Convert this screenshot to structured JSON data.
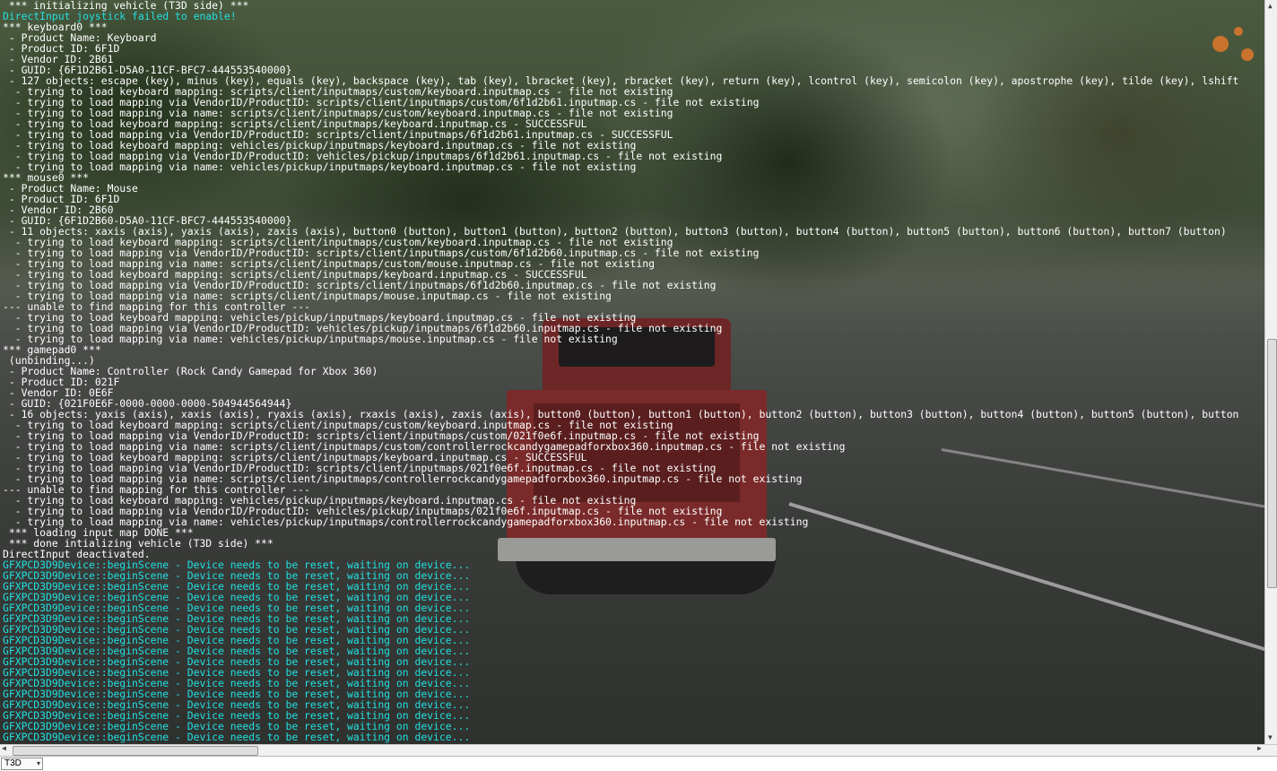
{
  "console": {
    "lines": [
      {
        "text": " *** initializing vehicle (T3D side) ***",
        "cyan": false
      },
      {
        "text": "DirectInput joystick failed to enable!",
        "cyan": true
      },
      {
        "text": "*** keyboard0 ***",
        "cyan": false
      },
      {
        "text": " - Product Name: Keyboard",
        "cyan": false
      },
      {
        "text": " - Product ID: 6F1D",
        "cyan": false
      },
      {
        "text": " - Vendor ID: 2B61",
        "cyan": false
      },
      {
        "text": " - GUID: {6F1D2B61-D5A0-11CF-BFC7-444553540000}",
        "cyan": false
      },
      {
        "text": " - 127 objects: escape (key), minus (key), equals (key), backspace (key), tab (key), lbracket (key), rbracket (key), return (key), lcontrol (key), semicolon (key), apostrophe (key), tilde (key), lshift",
        "cyan": false
      },
      {
        "text": "  - trying to load keyboard mapping: scripts/client/inputmaps/custom/keyboard.inputmap.cs - file not existing",
        "cyan": false
      },
      {
        "text": "  - trying to load mapping via VendorID/ProductID: scripts/client/inputmaps/custom/6f1d2b61.inputmap.cs - file not existing",
        "cyan": false
      },
      {
        "text": "  - trying to load mapping via name: scripts/client/inputmaps/custom/keyboard.inputmap.cs - file not existing",
        "cyan": false
      },
      {
        "text": "  - trying to load keyboard mapping: scripts/client/inputmaps/keyboard.inputmap.cs - SUCCESSFUL",
        "cyan": false
      },
      {
        "text": "  - trying to load mapping via VendorID/ProductID: scripts/client/inputmaps/6f1d2b61.inputmap.cs - SUCCESSFUL",
        "cyan": false
      },
      {
        "text": "  - trying to load keyboard mapping: vehicles/pickup/inputmaps/keyboard.inputmap.cs - file not existing",
        "cyan": false
      },
      {
        "text": "  - trying to load mapping via VendorID/ProductID: vehicles/pickup/inputmaps/6f1d2b61.inputmap.cs - file not existing",
        "cyan": false
      },
      {
        "text": "  - trying to load mapping via name: vehicles/pickup/inputmaps/keyboard.inputmap.cs - file not existing",
        "cyan": false
      },
      {
        "text": "*** mouse0 ***",
        "cyan": false
      },
      {
        "text": " - Product Name: Mouse",
        "cyan": false
      },
      {
        "text": " - Product ID: 6F1D",
        "cyan": false
      },
      {
        "text": " - Vendor ID: 2B60",
        "cyan": false
      },
      {
        "text": " - GUID: {6F1D2B60-D5A0-11CF-BFC7-444553540000}",
        "cyan": false
      },
      {
        "text": " - 11 objects: xaxis (axis), yaxis (axis), zaxis (axis), button0 (button), button1 (button), button2 (button), button3 (button), button4 (button), button5 (button), button6 (button), button7 (button)",
        "cyan": false
      },
      {
        "text": "  - trying to load keyboard mapping: scripts/client/inputmaps/custom/keyboard.inputmap.cs - file not existing",
        "cyan": false
      },
      {
        "text": "  - trying to load mapping via VendorID/ProductID: scripts/client/inputmaps/custom/6f1d2b60.inputmap.cs - file not existing",
        "cyan": false
      },
      {
        "text": "  - trying to load mapping via name: scripts/client/inputmaps/custom/mouse.inputmap.cs - file not existing",
        "cyan": false
      },
      {
        "text": "  - trying to load keyboard mapping: scripts/client/inputmaps/keyboard.inputmap.cs - SUCCESSFUL",
        "cyan": false
      },
      {
        "text": "  - trying to load mapping via VendorID/ProductID: scripts/client/inputmaps/6f1d2b60.inputmap.cs - file not existing",
        "cyan": false
      },
      {
        "text": "  - trying to load mapping via name: scripts/client/inputmaps/mouse.inputmap.cs - file not existing",
        "cyan": false
      },
      {
        "text": "--- unable to find mapping for this controller ---",
        "cyan": false
      },
      {
        "text": "  - trying to load keyboard mapping: vehicles/pickup/inputmaps/keyboard.inputmap.cs - file not existing",
        "cyan": false
      },
      {
        "text": "  - trying to load mapping via VendorID/ProductID: vehicles/pickup/inputmaps/6f1d2b60.inputmap.cs - file not existing",
        "cyan": false
      },
      {
        "text": "  - trying to load mapping via name: vehicles/pickup/inputmaps/mouse.inputmap.cs - file not existing",
        "cyan": false
      },
      {
        "text": "*** gamepad0 ***",
        "cyan": false
      },
      {
        "text": " (unbinding...)",
        "cyan": false
      },
      {
        "text": " - Product Name: Controller (Rock Candy Gamepad for Xbox 360)",
        "cyan": false
      },
      {
        "text": " - Product ID: 021F",
        "cyan": false
      },
      {
        "text": " - Vendor ID: 0E6F",
        "cyan": false
      },
      {
        "text": " - GUID: {021F0E6F-0000-0000-0000-504944564944}",
        "cyan": false
      },
      {
        "text": " - 16 objects: yaxis (axis), xaxis (axis), ryaxis (axis), rxaxis (axis), zaxis (axis), button0 (button), button1 (button), button2 (button), button3 (button), button4 (button), button5 (button), button",
        "cyan": false
      },
      {
        "text": "  - trying to load keyboard mapping: scripts/client/inputmaps/custom/keyboard.inputmap.cs - file not existing",
        "cyan": false
      },
      {
        "text": "  - trying to load mapping via VendorID/ProductID: scripts/client/inputmaps/custom/021f0e6f.inputmap.cs - file not existing",
        "cyan": false
      },
      {
        "text": "  - trying to load mapping via name: scripts/client/inputmaps/custom/controllerrockcandygamepadforxbox360.inputmap.cs - file not existing",
        "cyan": false
      },
      {
        "text": "  - trying to load keyboard mapping: scripts/client/inputmaps/keyboard.inputmap.cs - SUCCESSFUL",
        "cyan": false
      },
      {
        "text": "  - trying to load mapping via VendorID/ProductID: scripts/client/inputmaps/021f0e6f.inputmap.cs - file not existing",
        "cyan": false
      },
      {
        "text": "  - trying to load mapping via name: scripts/client/inputmaps/controllerrockcandygamepadforxbox360.inputmap.cs - file not existing",
        "cyan": false
      },
      {
        "text": "--- unable to find mapping for this controller ---",
        "cyan": false
      },
      {
        "text": "  - trying to load keyboard mapping: vehicles/pickup/inputmaps/keyboard.inputmap.cs - file not existing",
        "cyan": false
      },
      {
        "text": "  - trying to load mapping via VendorID/ProductID: vehicles/pickup/inputmaps/021f0e6f.inputmap.cs - file not existing",
        "cyan": false
      },
      {
        "text": "  - trying to load mapping via name: vehicles/pickup/inputmaps/controllerrockcandygamepadforxbox360.inputmap.cs - file not existing",
        "cyan": false
      },
      {
        "text": " *** loading input map DONE ***",
        "cyan": false
      },
      {
        "text": " *** done intializing vehicle (T3D side) ***",
        "cyan": false
      },
      {
        "text": "DirectInput deactivated.",
        "cyan": false
      },
      {
        "text": "GFXPCD3D9Device::beginScene - Device needs to be reset, waiting on device...",
        "cyan": true
      },
      {
        "text": "GFXPCD3D9Device::beginScene - Device needs to be reset, waiting on device...",
        "cyan": true
      },
      {
        "text": "GFXPCD3D9Device::beginScene - Device needs to be reset, waiting on device...",
        "cyan": true
      },
      {
        "text": "GFXPCD3D9Device::beginScene - Device needs to be reset, waiting on device...",
        "cyan": true
      },
      {
        "text": "GFXPCD3D9Device::beginScene - Device needs to be reset, waiting on device...",
        "cyan": true
      },
      {
        "text": "GFXPCD3D9Device::beginScene - Device needs to be reset, waiting on device...",
        "cyan": true
      },
      {
        "text": "GFXPCD3D9Device::beginScene - Device needs to be reset, waiting on device...",
        "cyan": true
      },
      {
        "text": "GFXPCD3D9Device::beginScene - Device needs to be reset, waiting on device...",
        "cyan": true
      },
      {
        "text": "GFXPCD3D9Device::beginScene - Device needs to be reset, waiting on device...",
        "cyan": true
      },
      {
        "text": "GFXPCD3D9Device::beginScene - Device needs to be reset, waiting on device...",
        "cyan": true
      },
      {
        "text": "GFXPCD3D9Device::beginScene - Device needs to be reset, waiting on device...",
        "cyan": true
      },
      {
        "text": "GFXPCD3D9Device::beginScene - Device needs to be reset, waiting on device...",
        "cyan": true
      },
      {
        "text": "GFXPCD3D9Device::beginScene - Device needs to be reset, waiting on device...",
        "cyan": true
      },
      {
        "text": "GFXPCD3D9Device::beginScene - Device needs to be reset, waiting on device...",
        "cyan": true
      },
      {
        "text": "GFXPCD3D9Device::beginScene - Device needs to be reset, waiting on device...",
        "cyan": true
      },
      {
        "text": "GFXPCD3D9Device::beginScene - Device needs to be reset, waiting on device...",
        "cyan": true
      },
      {
        "text": "GFXPCD3D9Device::beginScene - Device needs to be reset, waiting on device...",
        "cyan": true
      }
    ]
  },
  "colors": {
    "log_text": "#ffffff",
    "log_highlight": "#21e0e0"
  },
  "bottom_bar": {
    "scope_value": "T3D",
    "command_value": ""
  },
  "icons": {
    "chevron_down": "▾",
    "scroll_up": "▲",
    "scroll_down": "▼",
    "scroll_left": "◀",
    "scroll_right": "▶"
  }
}
